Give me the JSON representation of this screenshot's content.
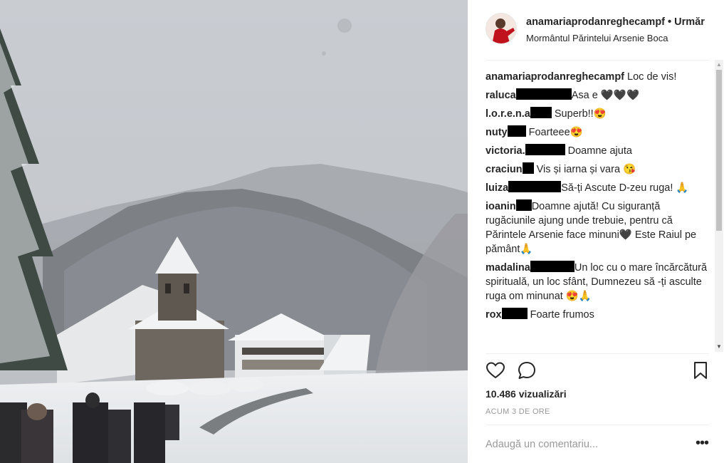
{
  "post": {
    "username": "anamariaprodanreghecampf",
    "follow_label": "• Urmăr",
    "location": "Mormântul Părintelui Arsenie Boca"
  },
  "comments": [
    {
      "user": "anamariaprodanreghecampf",
      "redacted": false,
      "text": " Loc de vis!"
    },
    {
      "user": "raluca",
      "redacted": true,
      "text": "Asa e 🖤🖤🖤"
    },
    {
      "user": "l.o.r.e.n.a",
      "redacted": true,
      "text": " Superb!!😍"
    },
    {
      "user": "nuty",
      "redacted": true,
      "text": " Foarteee😍"
    },
    {
      "user": "victoria.",
      "redacted": true,
      "text": " Doamne ajuta"
    },
    {
      "user": "craciun",
      "redacted": true,
      "text": " Vis și iarna și vara 😘"
    },
    {
      "user": "luiza",
      "redacted": true,
      "text": "Să-ți Ascute D-zeu ruga! 🙏"
    },
    {
      "user": "ioanin",
      "redacted": true,
      "text": "Doamne ajută! Cu siguranță rugăciunile ajung unde trebuie, pentru că Părintele Arsenie face minuni🖤 Este Raiul pe pământ🙏"
    },
    {
      "user": "madalina",
      "redacted": true,
      "text": "Un loc cu o mare încărcătură spirituală, un loc sfânt, Dumnezeu să -ți asculte ruga om minunat 😍🙏"
    },
    {
      "user": "rox",
      "redacted": true,
      "text": " Foarte frumos"
    }
  ],
  "stats": {
    "views": "10.486 vizualizări",
    "time": "ACUM 3 DE ORE"
  },
  "composer": {
    "placeholder": "Adaugă un comentariu...",
    "more": "•••"
  },
  "icons": {
    "like": "heart-icon",
    "comment": "comment-icon",
    "save": "bookmark-icon",
    "more": "more-options-icon"
  }
}
